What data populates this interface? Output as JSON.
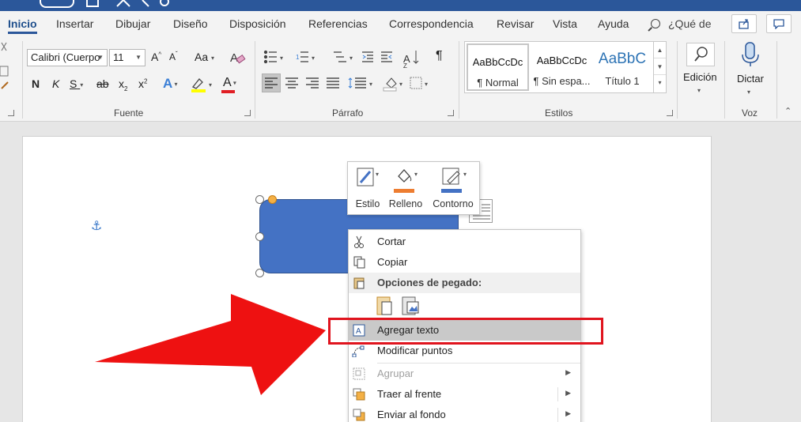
{
  "tabs": [
    {
      "label": "Inicio",
      "active": true
    },
    {
      "label": "Insertar"
    },
    {
      "label": "Dibujar"
    },
    {
      "label": "Diseño"
    },
    {
      "label": "Disposición"
    },
    {
      "label": "Referencias"
    },
    {
      "label": "Correspondencia"
    },
    {
      "label": "Revisar"
    },
    {
      "label": "Vista"
    },
    {
      "label": "Ayuda"
    }
  ],
  "tell_me": "¿Qué de",
  "ribbon": {
    "font": {
      "name": "Calibri (Cuerpo",
      "size": "11",
      "grow": "A",
      "shrink": "A",
      "case": "Aa",
      "bold": "N",
      "italic": "K",
      "underline": "S",
      "strike": "ab",
      "sub": "x",
      "sup": "x",
      "text_effects": "A",
      "font_color": "A",
      "group_label": "Fuente"
    },
    "paragraph": {
      "group_label": "Párrafo",
      "show_marks": "¶"
    },
    "styles": {
      "group_label": "Estilos",
      "items": [
        {
          "sample": "AaBbCcDc",
          "name": "¶ Normal"
        },
        {
          "sample": "AaBbCcDc",
          "name": "¶ Sin espa..."
        },
        {
          "sample": "AaBbC",
          "name": "Título 1"
        }
      ]
    },
    "editing": {
      "label": "Edición"
    },
    "voice": {
      "label": "Dictar",
      "group_label": "Voz"
    }
  },
  "mini_toolbar": [
    {
      "label": "Estilo"
    },
    {
      "label": "Relleno",
      "color": "#ed7d31"
    },
    {
      "label": "Contorno",
      "color": "#4472c4"
    }
  ],
  "context_menu": {
    "cut": "Cortar",
    "copy": "Copiar",
    "paste_options": "Opciones de pegado:",
    "add_text": "Agregar texto",
    "edit_points": "Modificar puntos",
    "group": "Agrupar",
    "bring_front": "Traer al frente",
    "send_back": "Enviar al fondo"
  },
  "colors": {
    "accent": "#2b579a",
    "shape_fill": "#4472c4",
    "highlight_red": "#e0141e",
    "arrow_red": "#ee1111"
  }
}
